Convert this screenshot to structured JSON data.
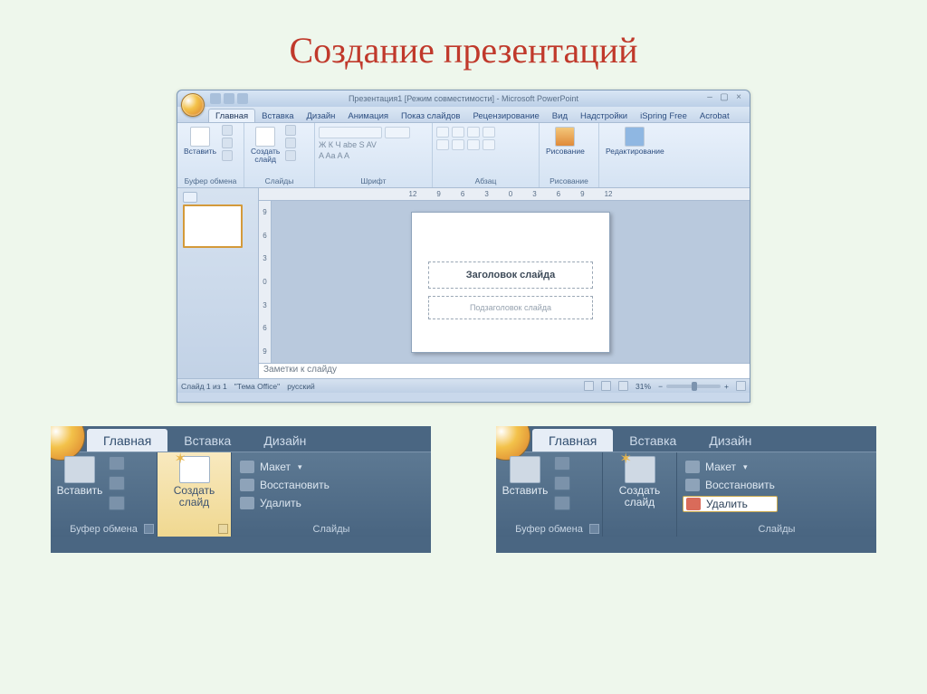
{
  "page": {
    "title": "Создание презентаций"
  },
  "ppwin": {
    "title": "Презентация1 [Режим совместимости] - Microsoft PowerPoint",
    "tabs": [
      "Главная",
      "Вставка",
      "Дизайн",
      "Анимация",
      "Показ слайдов",
      "Рецензирование",
      "Вид",
      "Надстройки",
      "iSpring Free",
      "Acrobat"
    ],
    "ribbon": {
      "clipboard": {
        "paste": "Вставить",
        "label": "Буфер обмена"
      },
      "slides": {
        "newslide": "Создать\nслайд",
        "label": "Слайды"
      },
      "font": {
        "label": "Шрифт",
        "formula_row": "Ж  К  Ч  abe  S  AV",
        "size_row": "A  Aa  A  A"
      },
      "paragraph": {
        "label": "Абзац"
      },
      "drawing": {
        "label": "Рисование",
        "btn": "Рисование"
      },
      "editing": {
        "label": "",
        "btn": "Редактирование"
      }
    },
    "ruler_h": [
      "12",
      "9",
      "6",
      "3",
      "0",
      "3",
      "6",
      "9",
      "12"
    ],
    "ruler_v": [
      "9",
      "6",
      "3",
      "0",
      "3",
      "6",
      "9"
    ],
    "slide": {
      "title_ph": "Заголовок слайда",
      "sub_ph": "Подзаголовок слайда"
    },
    "notes": "Заметки к слайду",
    "status": {
      "slide": "Слайд 1 из 1",
      "theme": "\"Тема Office\"",
      "lang": "русский",
      "zoom": "31%"
    }
  },
  "crop": {
    "tabs": [
      "Главная",
      "Вставка",
      "Дизайн"
    ],
    "clipboard": {
      "paste": "Вставить",
      "label": "Буфер обмена"
    },
    "slides_group_label": "Слайды",
    "newslide": "Создать\nслайд",
    "items": {
      "layout": "Макет",
      "reset": "Восстановить",
      "delete": "Удалить"
    }
  }
}
